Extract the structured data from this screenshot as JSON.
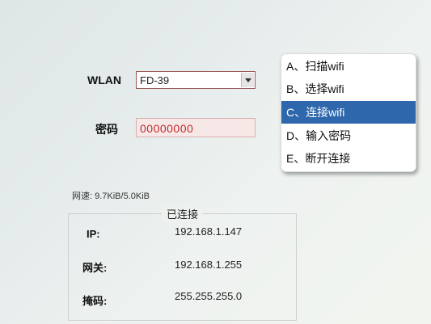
{
  "wlan": {
    "label": "WLAN",
    "selected": "FD-39"
  },
  "password": {
    "label": "密码",
    "value": "00000000"
  },
  "menu": {
    "items": [
      {
        "label": "A、扫描wifi",
        "selected": false
      },
      {
        "label": "B、选择wifi",
        "selected": false
      },
      {
        "label": "C、连接wifi",
        "selected": true
      },
      {
        "label": "D、输入密码",
        "selected": false
      },
      {
        "label": "E、断开连接",
        "selected": false
      }
    ]
  },
  "speed": "网速: 9.7KiB/5.0KiB",
  "status": {
    "title": "已连接",
    "ip_label": "IP:",
    "ip_value": "192.168.1.147",
    "gateway_label": "网关:",
    "gateway_value": "192.168.1.255",
    "mask_label": "掩码:",
    "mask_value": "255.255.255.0"
  },
  "colors": {
    "selection": "#2e67ab",
    "password_text": "#c02a2a"
  }
}
